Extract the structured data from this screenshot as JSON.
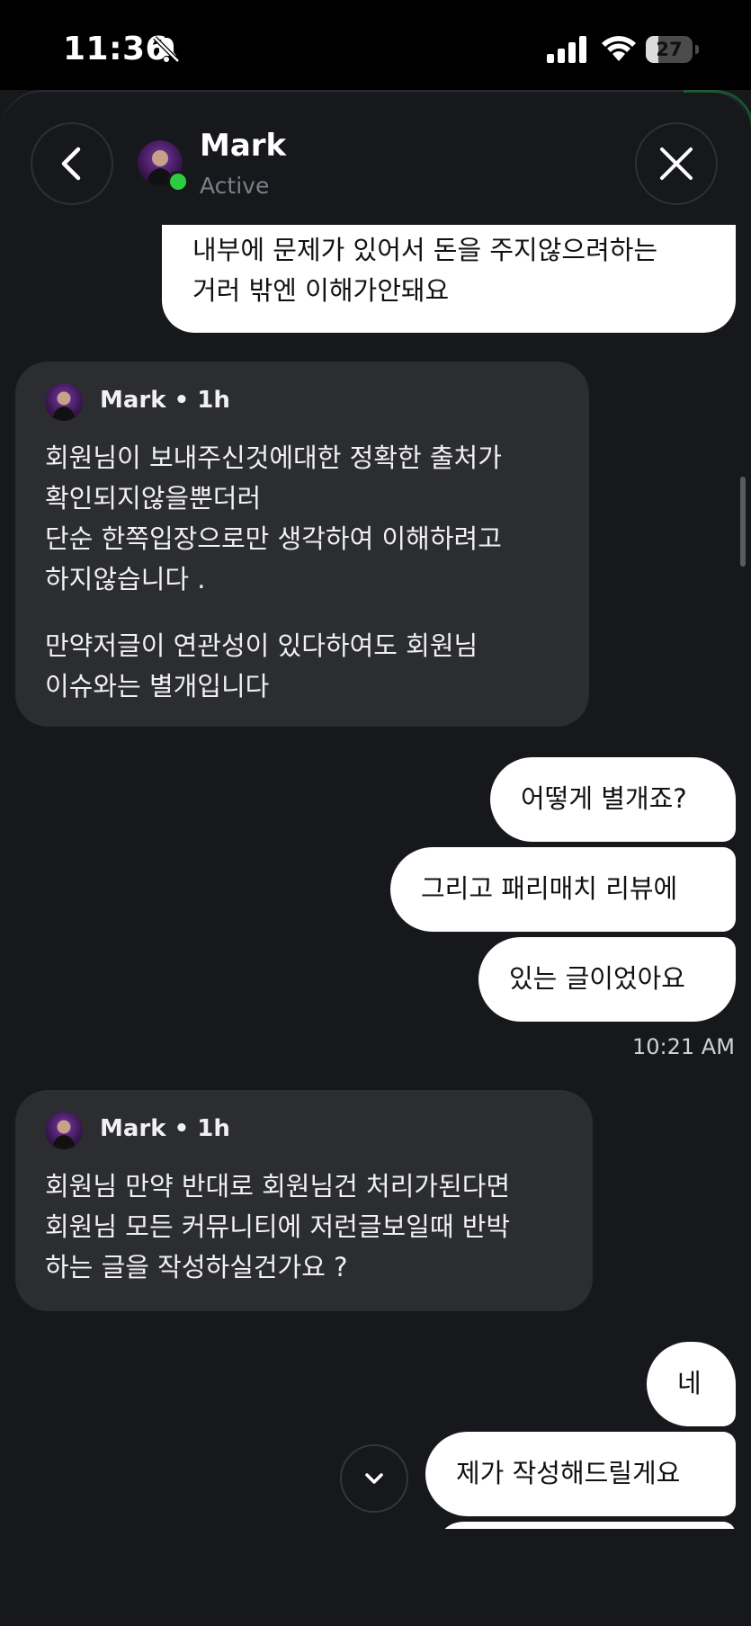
{
  "status_bar": {
    "time": "11:36",
    "battery_level": "27"
  },
  "header": {
    "name": "Mark",
    "status": "Active"
  },
  "messages": {
    "out_1": {
      "lines": "내부에 문제가 있어서 돈을 주지않으려하는\n거러 밖엔 이해가안돼요"
    },
    "in_1": {
      "sender": "Mark • 1h",
      "paragraph_1": "회원님이 보내주신것에대한 정확한 출처가\n확인되지않을뿐더러\n단순 한쪽입장으로만 생각하여 이해하려고\n하지않습니다 .",
      "paragraph_2": "만약저글이 연관성이 있다하여도 회원님\n이슈와는 별개입니다"
    },
    "out_2": "어떻게 별개죠?",
    "out_3": "그리고 패리매치 리뷰에",
    "out_4": "있는 글이었아요",
    "timestamp_1": "10:21 AM",
    "in_2": {
      "sender": "Mark • 1h",
      "text": "회원님 만약 반대로 회원님건 처리가된다면\n회원님 모든 커뮤니티에 저런글보일때 반박\n하는 글을 작성하실건가요 ?"
    },
    "out_5": "네",
    "out_6": "제가 작성해드릴게요"
  },
  "icons": {
    "back": "chevron-left-icon",
    "close": "close-icon",
    "scroll_down": "chevron-down-icon",
    "silent": "bell-slash-icon"
  },
  "colors": {
    "accent_online": "#2ecc40",
    "bubble_out": "#ffffff",
    "bubble_in": "#2c2d31",
    "background": "#17181c"
  }
}
